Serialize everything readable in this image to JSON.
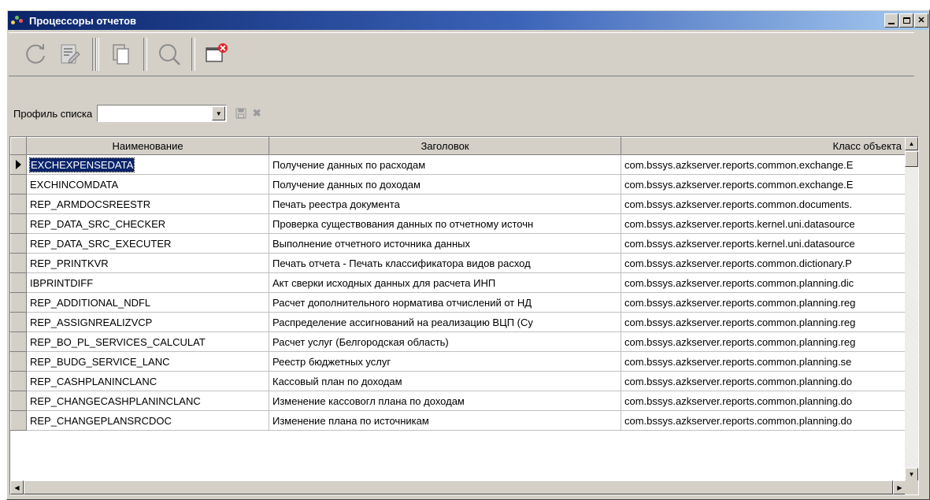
{
  "window": {
    "title": "Процессоры отчетов",
    "controls": [
      "minimize-icon",
      "maximize-icon",
      "close-icon"
    ]
  },
  "toolbar": {
    "buttons": [
      "refresh-icon",
      "edit-icon",
      "copy-icon",
      "search-icon",
      "close-window-icon"
    ]
  },
  "filter": {
    "label": "Профиль списка",
    "value": "",
    "icons": [
      "save-icon",
      "delete-icon"
    ]
  },
  "grid": {
    "columns": [
      "Наименование",
      "Заголовок",
      "Класс объекта"
    ],
    "selected_row": 0,
    "rows": [
      [
        "EXCHEXPENSEDATA",
        "Получение данных по расходам",
        "com.bssys.azkserver.reports.common.exchange.E"
      ],
      [
        "EXCHINCOMDATA",
        "Получение данных по доходам",
        "com.bssys.azkserver.reports.common.exchange.E"
      ],
      [
        "REP_ARMDOCSREESTR",
        "Печать реестра документа",
        "com.bssys.azkserver.reports.common.documents."
      ],
      [
        "REP_DATA_SRC_CHECKER",
        "Проверка существования данных по отчетному источн",
        "com.bssys.azkserver.reports.kernel.uni.datasource"
      ],
      [
        "REP_DATA_SRC_EXECUTER",
        "Выполнение отчетного источника данных",
        "com.bssys.azkserver.reports.kernel.uni.datasource"
      ],
      [
        "REP_PRINTKVR",
        "Печать отчета - Печать классификатора видов расход",
        "com.bssys.azkserver.reports.common.dictionary.P"
      ],
      [
        "IBPRINTDIFF",
        "Акт сверки исходных данных для расчета ИНП",
        "com.bssys.azkserver.reports.common.planning.dic"
      ],
      [
        "REP_ADDITIONAL_NDFL",
        "Расчет дополнительного норматива отчислений от НД",
        "com.bssys.azkserver.reports.common.planning.reg"
      ],
      [
        "REP_ASSIGNREALIZVCP",
        "Распределение ассигнований на реализацию ВЦП (Су",
        "com.bssys.azkserver.reports.common.planning.reg"
      ],
      [
        "REP_BO_PL_SERVICES_CALCULAT",
        "Расчет услуг (Белгородская область)",
        "com.bssys.azkserver.reports.common.planning.reg"
      ],
      [
        "REP_BUDG_SERVICE_LANC",
        "Реестр бюджетных услуг",
        "com.bssys.azkserver.reports.common.planning.se"
      ],
      [
        "REP_CASHPLANINCLANC",
        "Кассовый план по доходам",
        "com.bssys.azkserver.reports.common.planning.do"
      ],
      [
        "REP_CHANGECASHPLANINCLANC",
        "Изменение кассовогл плана по доходам",
        "com.bssys.azkserver.reports.common.planning.do"
      ],
      [
        "REP_CHANGEPLANSRCDOC",
        "Изменение плана по источникам",
        "com.bssys.azkserver.reports.common.planning.do"
      ]
    ]
  }
}
